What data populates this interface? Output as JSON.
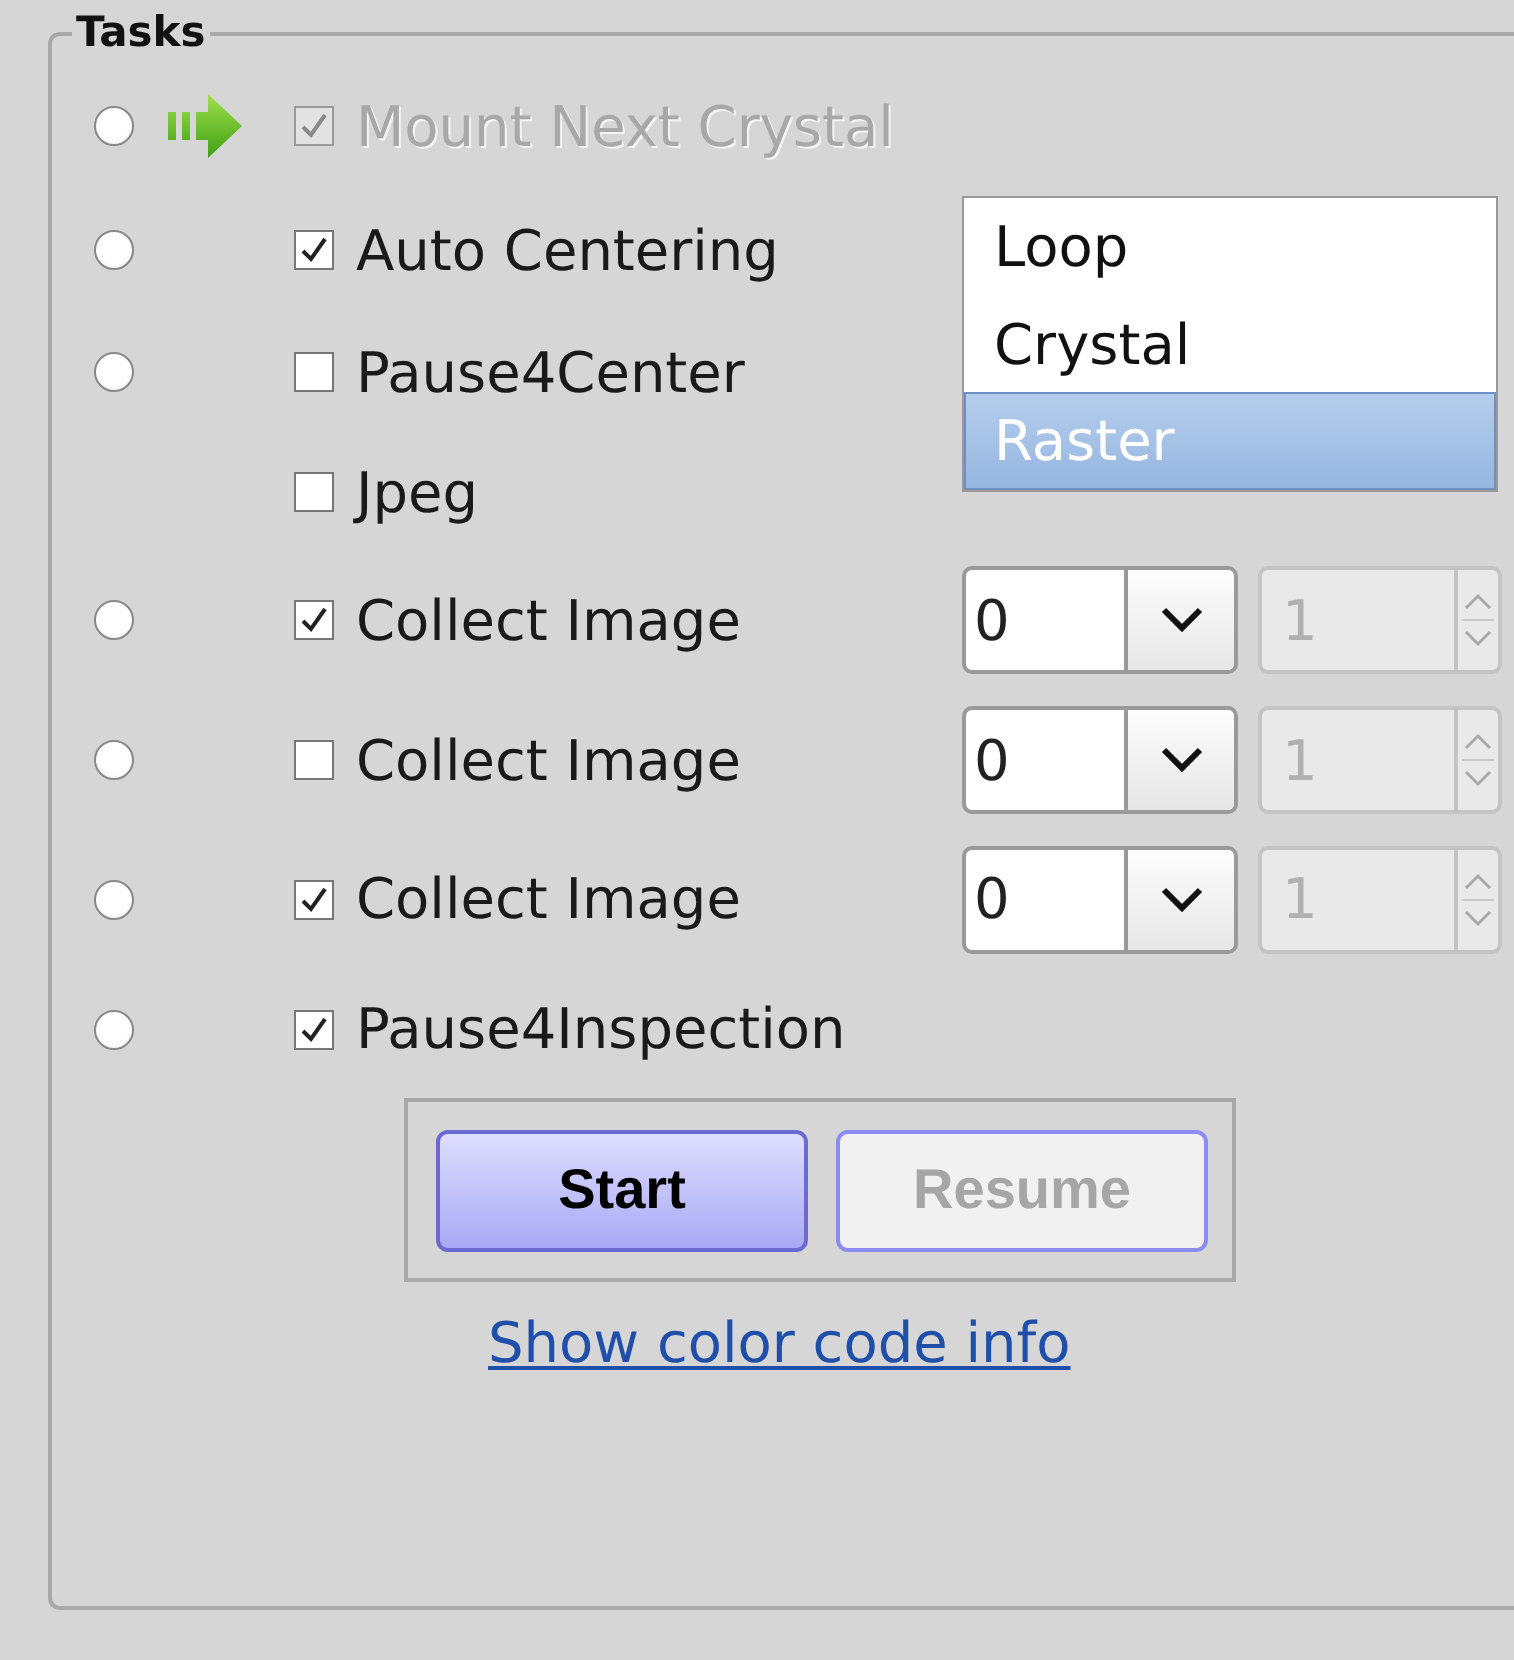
{
  "group": {
    "title": "Tasks"
  },
  "tasks": [
    {
      "kind": "task",
      "radio_selected": false,
      "current": true,
      "checked": true,
      "disabled": true,
      "label": "Mount Next Crystal"
    },
    {
      "kind": "task",
      "radio_selected": false,
      "current": false,
      "checked": true,
      "disabled": false,
      "label": "Auto Centering"
    },
    {
      "kind": "task",
      "radio_selected": false,
      "current": false,
      "checked": false,
      "disabled": false,
      "label": "Pause4Center"
    },
    {
      "kind": "option",
      "checked": false,
      "disabled": false,
      "label": "Jpeg"
    },
    {
      "kind": "collect",
      "radio_selected": false,
      "current": false,
      "checked": true,
      "disabled": false,
      "label": "Collect Image",
      "combo": "0",
      "spin": "1"
    },
    {
      "kind": "collect",
      "radio_selected": false,
      "current": false,
      "checked": false,
      "disabled": false,
      "label": "Collect Image",
      "combo": "0",
      "spin": "1"
    },
    {
      "kind": "collect",
      "radio_selected": false,
      "current": false,
      "checked": true,
      "disabled": false,
      "label": "Collect Image",
      "combo": "0",
      "spin": "1"
    },
    {
      "kind": "task",
      "radio_selected": false,
      "current": false,
      "checked": true,
      "disabled": false,
      "label": "Pause4Inspection"
    }
  ],
  "centering_modes": [
    {
      "label": "Loop",
      "selected": false
    },
    {
      "label": "Crystal",
      "selected": false
    },
    {
      "label": "Raster",
      "selected": true
    }
  ],
  "buttons": [
    {
      "label": "Start",
      "disabled": false
    },
    {
      "label": "Resume",
      "disabled": true
    }
  ],
  "link": "Show color code info"
}
